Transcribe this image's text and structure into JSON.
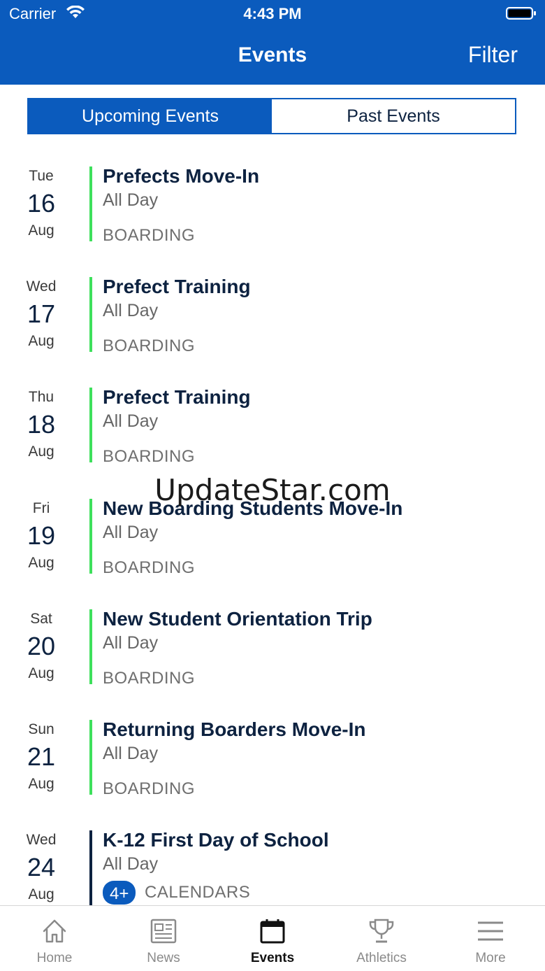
{
  "status_bar": {
    "carrier": "Carrier",
    "time": "4:43 PM"
  },
  "header": {
    "title": "Events",
    "filter_label": "Filter"
  },
  "segmented": {
    "upcoming": "Upcoming Events",
    "past": "Past Events",
    "selected": "Upcoming Events"
  },
  "events": [
    {
      "dow": "Tue",
      "day": "16",
      "month": "Aug",
      "title": "Prefects Move-In",
      "time": "All Day",
      "category": "BOARDING"
    },
    {
      "dow": "Wed",
      "day": "17",
      "month": "Aug",
      "title": "Prefect Training",
      "time": "All Day",
      "category": "BOARDING"
    },
    {
      "dow": "Thu",
      "day": "18",
      "month": "Aug",
      "title": "Prefect Training",
      "time": "All Day",
      "category": "BOARDING"
    },
    {
      "dow": "Fri",
      "day": "19",
      "month": "Aug",
      "title": "New Boarding Students Move-In",
      "time": "All Day",
      "category": "BOARDING"
    },
    {
      "dow": "Sat",
      "day": "20",
      "month": "Aug",
      "title": "New Student Orientation Trip",
      "time": "All Day",
      "category": "BOARDING"
    },
    {
      "dow": "Sun",
      "day": "21",
      "month": "Aug",
      "title": "Returning Boarders Move-In",
      "time": "All Day",
      "category": "BOARDING"
    },
    {
      "dow": "Wed",
      "day": "24",
      "month": "Aug",
      "title": "K-12 First Day of School",
      "time": "All Day",
      "badge": "4+",
      "category": "CALENDARS"
    }
  ],
  "watermark": "UpdateStar.com",
  "tabbar": {
    "tabs": [
      {
        "label": "Home",
        "icon": "home-icon"
      },
      {
        "label": "News",
        "icon": "newspaper-icon"
      },
      {
        "label": "Events",
        "icon": "calendar-icon"
      },
      {
        "label": "Athletics",
        "icon": "trophy-icon"
      },
      {
        "label": "More",
        "icon": "menu-icon"
      }
    ],
    "selected": "Events"
  },
  "colors": {
    "brand": "#0b5bbd",
    "title_navy": "#0d2240",
    "boarding_bar": "#3ee05c",
    "calendars_bar": "#0d2240"
  }
}
